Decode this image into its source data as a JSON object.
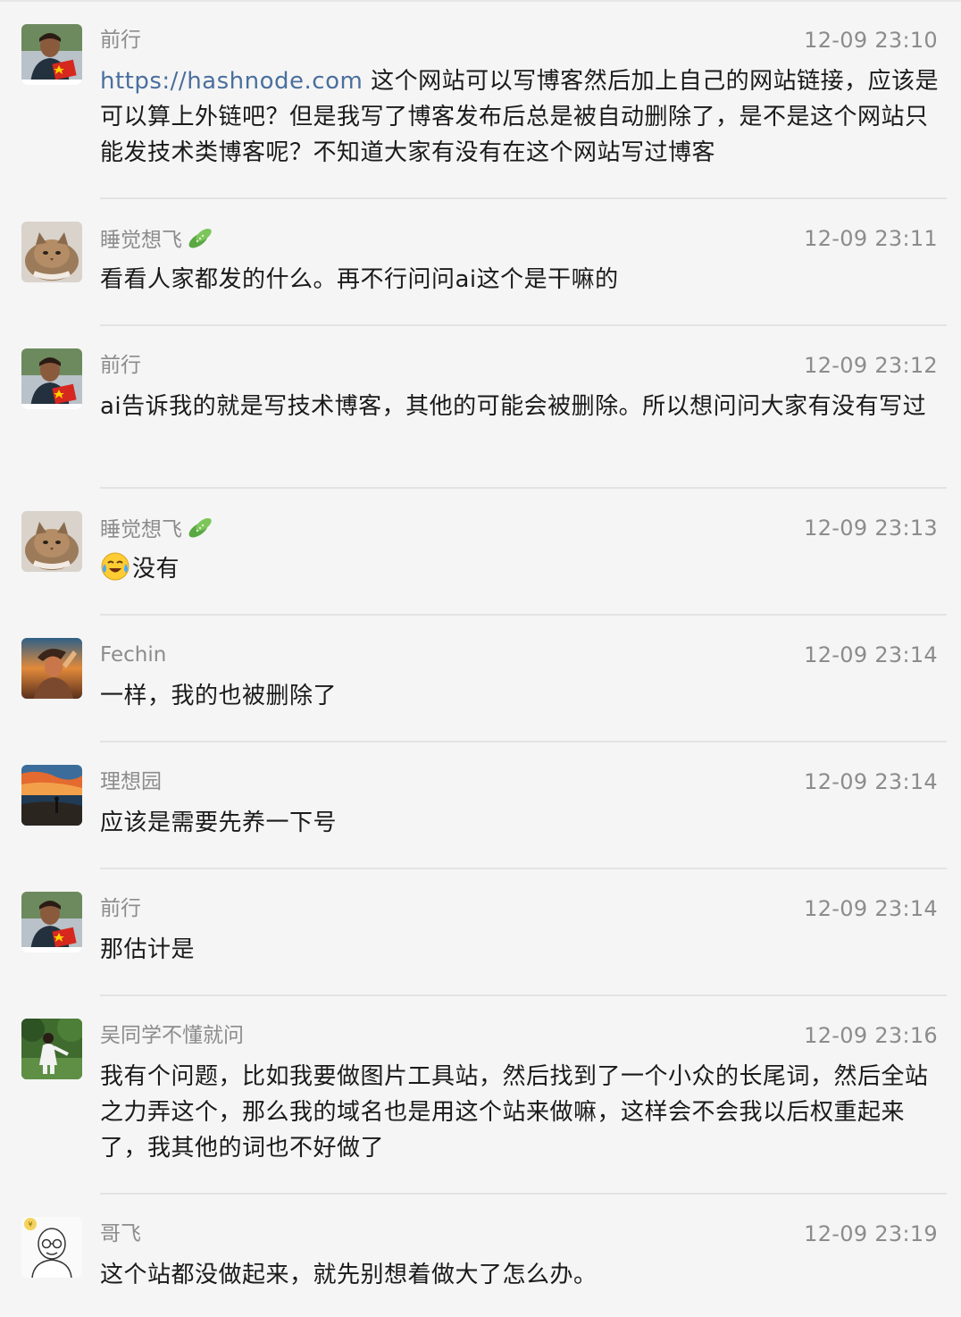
{
  "messages": [
    {
      "sender": "前行",
      "time": "12-09 23:10",
      "avatar": "man-with-flag-avatar",
      "link": "https://hashnode.com",
      "text_after_link": " 这个网站可以写博客然后加上自己的网站链接，应该是可以算上外链吧？但是我写了博客发布后总是被自动删除了，是不是这个网站只能发技术类博客呢？不知道大家有没有在这个网站写过博客"
    },
    {
      "sender": "睡觉想飞",
      "sender_tag_icon": "cucumber-icon",
      "time": "12-09 23:11",
      "avatar": "cat-avatar",
      "text": "看看人家都发的什么。再不行问问ai这个是干嘛的"
    },
    {
      "sender": "前行",
      "time": "12-09 23:12",
      "avatar": "man-with-flag-avatar",
      "text": "ai告诉我的就是写技术博客，其他的可能会被删除。所以想问问大家有没有写过"
    },
    {
      "sender": "睡觉想飞",
      "sender_tag_icon": "cucumber-icon",
      "time": "12-09 23:13",
      "avatar": "cat-avatar",
      "emoji": "crying-laughing-emoji",
      "text": "没有"
    },
    {
      "sender": "Fechin",
      "time": "12-09 23:14",
      "avatar": "sunset-portrait-avatar",
      "text": "一样，我的也被删除了"
    },
    {
      "sender": "理想园",
      "time": "12-09 23:14",
      "avatar": "lake-sunset-avatar",
      "text": "应该是需要先养一下号"
    },
    {
      "sender": "前行",
      "time": "12-09 23:14",
      "avatar": "man-with-flag-avatar",
      "text": "那估计是"
    },
    {
      "sender": "吴同学不懂就问",
      "time": "12-09 23:16",
      "avatar": "person-in-forest-avatar",
      "text": "我有个问题，比如我要做图片工具站，然后找到了一个小众的长尾词，然后全站之力弄这个，那么我的域名也是用这个站来做嘛，这样会不会我以后权重起来了，我其他的词也不好做了"
    },
    {
      "sender": "哥飞",
      "time": "12-09 23:19",
      "avatar": "cartoon-bald-man-avatar",
      "text": "这个站都没做起来，就先别想着做大了怎么办。"
    }
  ]
}
